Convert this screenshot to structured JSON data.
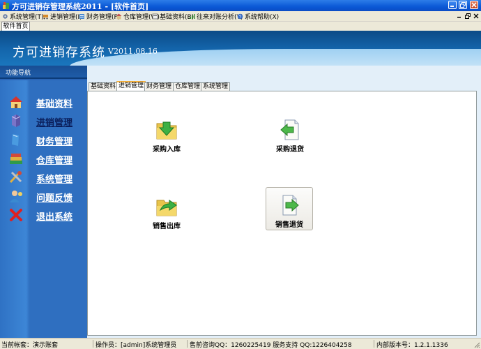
{
  "window": {
    "title": "方可进销存管理系统2011 - [软件首页]",
    "minimize_glyph": "_",
    "restore_glyph": "❐",
    "close_glyph": "✕"
  },
  "menu": {
    "items": [
      {
        "label": "系统管理(T)",
        "icon": "gear-icon"
      },
      {
        "label": "进销管理(I)",
        "icon": "cart-icon"
      },
      {
        "label": "财务管理(F)",
        "icon": "finance-icon"
      },
      {
        "label": "仓库管理(W)",
        "icon": "warehouse-icon"
      },
      {
        "label": "基础资料(B)",
        "icon": "data-icon"
      },
      {
        "label": "往来对账分析(Y)",
        "icon": "chart-icon"
      },
      {
        "label": "系统帮助(X)",
        "icon": "help-icon"
      }
    ]
  },
  "doc_tab": {
    "label": "软件首页"
  },
  "header": {
    "app_name": "方可进销存系统",
    "version": "V2011.08.16"
  },
  "sidebar": {
    "title": "功能导航",
    "items": [
      {
        "label": "基础资料",
        "icon": "house-icon"
      },
      {
        "label": "进销管理",
        "icon": "box-icon",
        "active": true
      },
      {
        "label": "财务管理",
        "icon": "notebook-icon"
      },
      {
        "label": "仓库管理",
        "icon": "books-icon"
      },
      {
        "label": "系统管理",
        "icon": "tools-icon"
      },
      {
        "label": "问题反馈",
        "icon": "user-icon"
      },
      {
        "label": "退出系统",
        "icon": "exit-icon"
      }
    ]
  },
  "function_tabs": {
    "items": [
      {
        "label": "基础资料"
      },
      {
        "label": "进销管理",
        "active": true
      },
      {
        "label": "财务管理"
      },
      {
        "label": "仓库管理"
      },
      {
        "label": "系统管理"
      }
    ]
  },
  "functions": {
    "purchase_in": {
      "label": "采购入库",
      "icon": "folder-down-arrow-icon"
    },
    "purchase_return": {
      "label": "采购退货",
      "icon": "document-left-arrow-icon"
    },
    "sales_out": {
      "label": "销售出库",
      "icon": "folder-right-arrow-icon"
    },
    "sales_return": {
      "label": "销售退货",
      "icon": "document-right-arrow-icon"
    }
  },
  "status": {
    "account": "当前帐套：演示账套",
    "operator": "操作员：[admin]系统管理员",
    "presales": "售前咨询QQ：1260225419 服务支持 QQ:1226404258",
    "version": "内部版本号：1.2.1.1336"
  },
  "colors": {
    "titlebar": "#0a58d6",
    "banner": "#1466ac",
    "sidebar": "#2f6fc0",
    "active_tab_accent": "#f9b138"
  }
}
